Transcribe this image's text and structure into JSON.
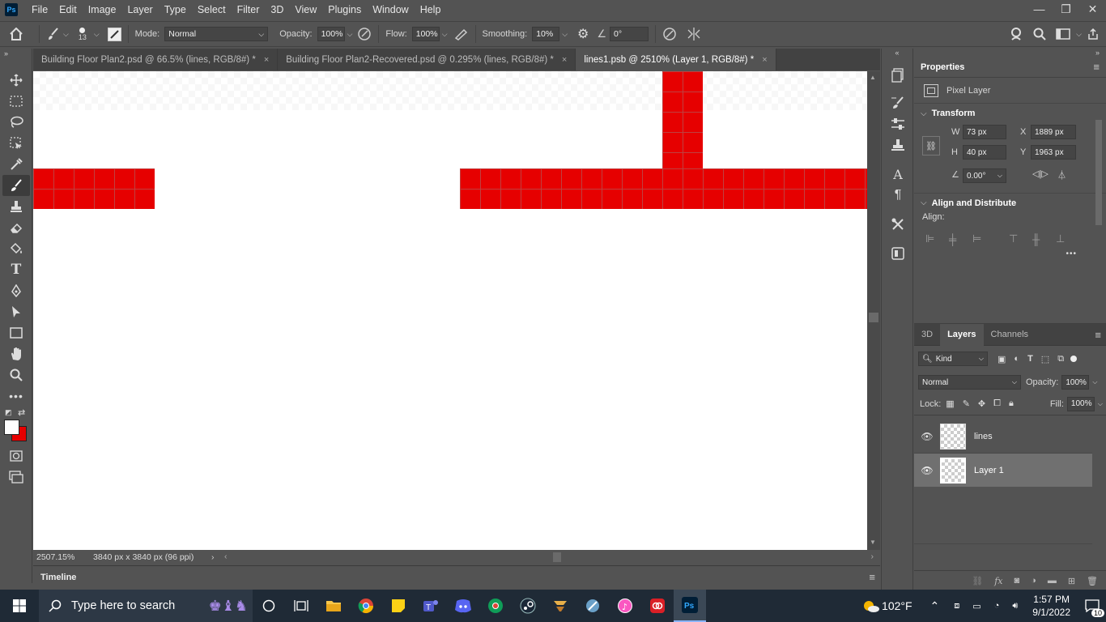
{
  "app": {
    "logo": "Ps"
  },
  "menu": [
    "File",
    "Edit",
    "Image",
    "Layer",
    "Type",
    "Select",
    "Filter",
    "3D",
    "View",
    "Plugins",
    "Window",
    "Help"
  ],
  "options": {
    "brush_size": "13",
    "mode_label": "Mode:",
    "mode_value": "Normal",
    "opacity_label": "Opacity:",
    "opacity_value": "100%",
    "flow_label": "Flow:",
    "flow_value": "100%",
    "smoothing_label": "Smoothing:",
    "smoothing_value": "10%",
    "angle_value": "0°"
  },
  "tabs": [
    {
      "label": "Building Floor Plan2.psd @ 66.5% (lines, RGB/8#) *",
      "close": "×"
    },
    {
      "label": "Building Floor Plan2-Recovered.psd @ 0.295% (lines, RGB/8#) *",
      "close": "×"
    },
    {
      "label": "lines1.psb @ 2510% (Layer 1, RGB/8#) *",
      "close": "×"
    }
  ],
  "status": {
    "zoom": "2507.15%",
    "doc_info": "3840 px x 3840 px (96 ppi)"
  },
  "timeline": {
    "label": "Timeline"
  },
  "properties": {
    "title": "Properties",
    "layer_type": "Pixel Layer",
    "transform_label": "Transform",
    "w_label": "W",
    "w_value": "73 px",
    "h_label": "H",
    "h_value": "40 px",
    "x_label": "X",
    "x_value": "1889 px",
    "y_label": "Y",
    "y_value": "1963 px",
    "angle_value": "0.00°",
    "align_label": "Align and Distribute",
    "align_sub": "Align:",
    "more": "•••"
  },
  "layers_panel": {
    "tabs": [
      "3D",
      "Layers",
      "Channels"
    ],
    "active_tab": "Layers",
    "filter_value": "Kind",
    "blend_value": "Normal",
    "opacity_label": "Opacity:",
    "opacity_value": "100%",
    "lock_label": "Lock:",
    "fill_label": "Fill:",
    "fill_value": "100%",
    "layers": [
      {
        "name": "lines",
        "selected": false
      },
      {
        "name": "Layer 1",
        "selected": true
      }
    ]
  },
  "taskbar": {
    "search_placeholder": "Type here to search",
    "weather": "102°F",
    "time": "1:57 PM",
    "date": "9/1/2022",
    "notification_count": "10"
  },
  "colors": {
    "foreground": "#ffffff",
    "background": "#e60000",
    "paint": "#e60000"
  }
}
